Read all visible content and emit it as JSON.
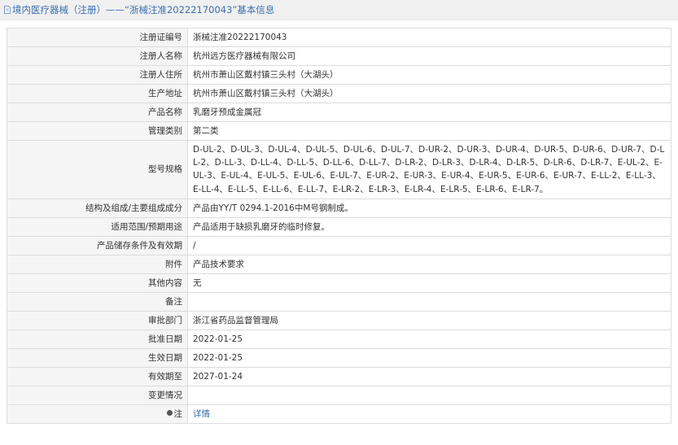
{
  "header": {
    "title": "境内医疗器械（注册）——“浙械注准20222170043”基本信息",
    "icon": "document-icon",
    "link_color": "#3a6fb0"
  },
  "rows": [
    {
      "label": "注册证编号",
      "value": "浙械注准20222170043"
    },
    {
      "label": "注册人名称",
      "value": "杭州远方医疗器械有限公司"
    },
    {
      "label": "注册人住所",
      "value": "杭州市萧山区戴村镇三头村（大湖头）"
    },
    {
      "label": "生产地址",
      "value": "杭州市萧山区戴村镇三头村（大湖头）"
    },
    {
      "label": "产品名称",
      "value": "乳磨牙预成金属冠"
    },
    {
      "label": "管理类别",
      "value": "第二类"
    },
    {
      "label": "型号规格",
      "value": "D-UL-2、D-UL-3、D-UL-4、D-UL-5、D-UL-6、D-UL-7、D-UR-2、D-UR-3、D-UR-4、D-UR-5、D-UR-6、D-UR-7、D-LL-2、D-LL-3、D-LL-4、D-LL-5、D-LL-6、D-LL-7、D-LR-2、D-LR-3、D-LR-4、D-LR-5、D-LR-6、D-LR-7、E-UL-2、E-UL-3、E-UL-4、E-UL-5、E-UL-6、E-UL-7、E-UR-2、E-UR-3、E-UR-4、E-UR-5、E-UR-6、E-UR-7、E-LL-2、E-LL-3、E-LL-4、E-LL-5、E-LL-6、E-LL-7、E-LR-2、E-LR-3、E-LR-4、E-LR-5、E-LR-6、E-LR-7。"
    },
    {
      "label": "结构及组成/主要组成成分",
      "value": "产品由YY/T 0294.1-2016中M号钢制成。"
    },
    {
      "label": "适用范围/预期用途",
      "value": "产品适用于缺损乳磨牙的临时修复。"
    },
    {
      "label": "产品储存条件及有效期",
      "value": "/"
    },
    {
      "label": "附件",
      "value": "产品技术要求"
    },
    {
      "label": "其他内容",
      "value": "无"
    },
    {
      "label": "备注",
      "value": ""
    },
    {
      "label": "审批部门",
      "value": "浙江省药品监督管理局"
    },
    {
      "label": "批准日期",
      "value": "2022-01-25"
    },
    {
      "label": "生效日期",
      "value": "2022-01-25"
    },
    {
      "label": "有效期至",
      "value": "2027-01-24"
    },
    {
      "label": "变更情况",
      "value": ""
    }
  ],
  "note_row": {
    "label": "注",
    "icon": "bullet-icon",
    "link_text": "详情"
  }
}
